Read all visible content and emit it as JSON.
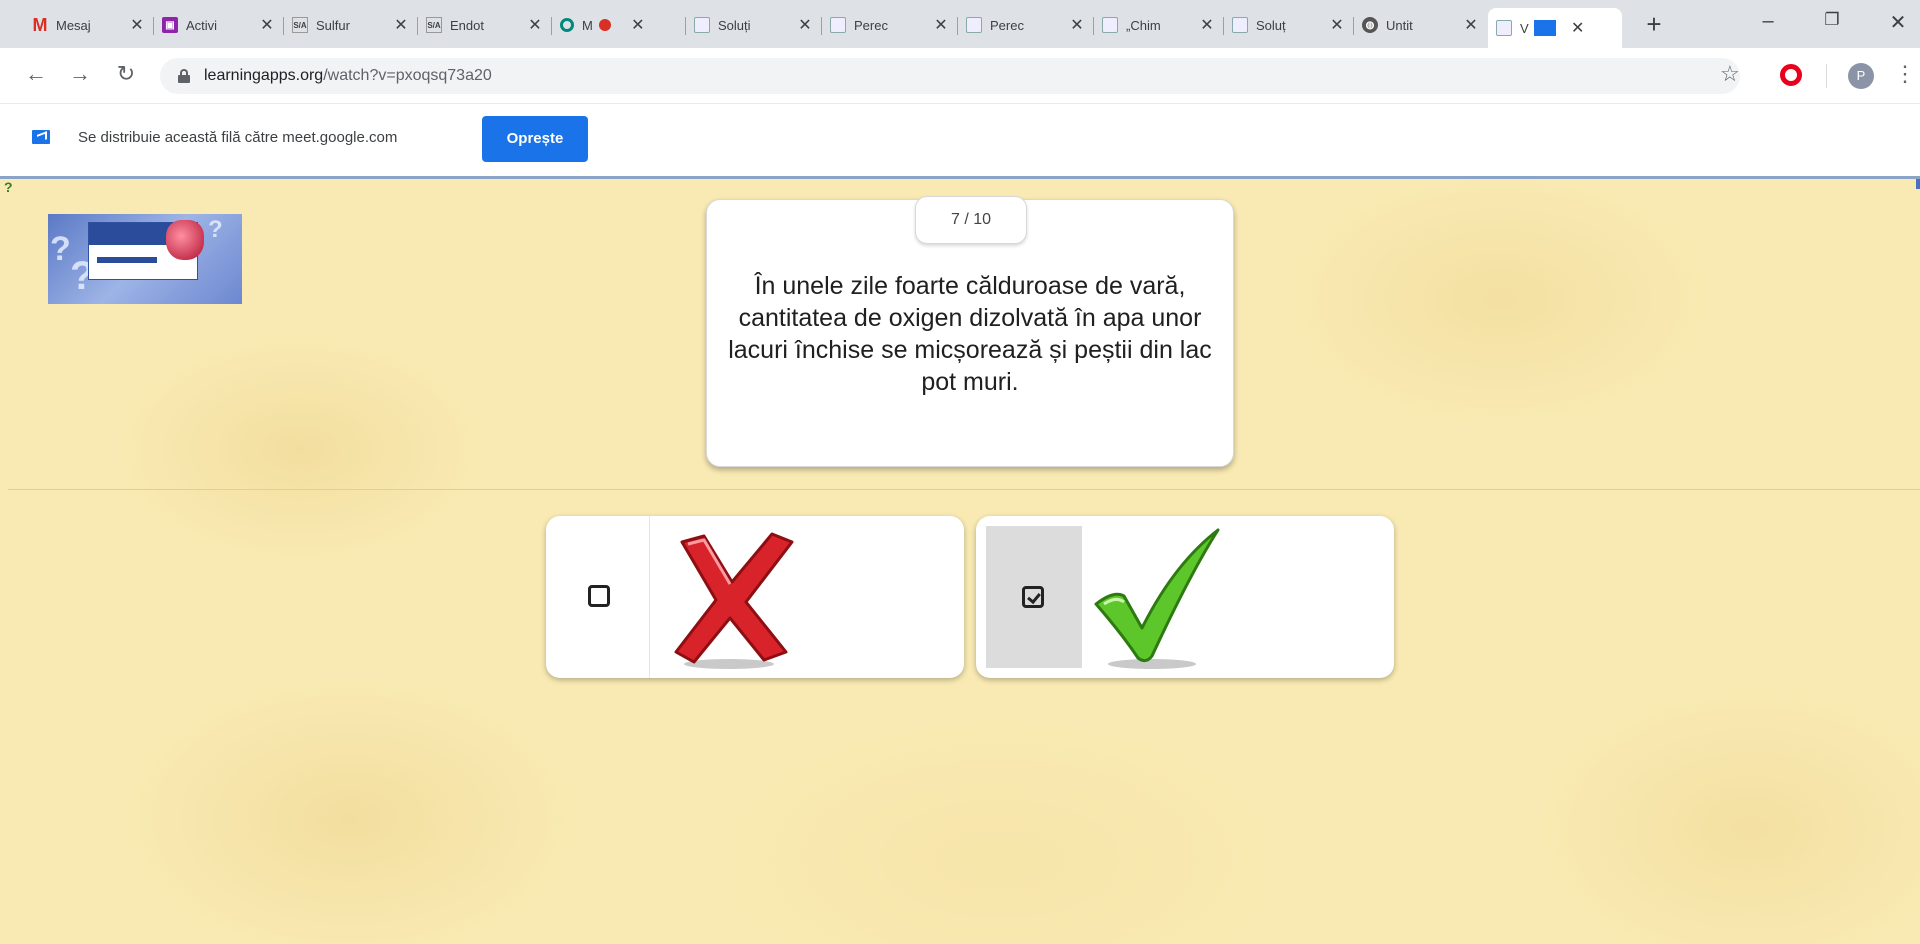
{
  "tabs": [
    {
      "label": "Mesaj",
      "icon": "gmail-icon"
    },
    {
      "label": "Activi",
      "icon": "classroom-icon"
    },
    {
      "label": "Sulfur",
      "icon": "sa-icon"
    },
    {
      "label": "Endot",
      "icon": "sa-icon"
    },
    {
      "label": "M",
      "icon": "meet-icon"
    },
    {
      "label": "Soluți",
      "icon": "learningapps-icon"
    },
    {
      "label": "Perec",
      "icon": "learningapps-icon"
    },
    {
      "label": "Perec",
      "icon": "learningapps-icon"
    },
    {
      "label": "„Chim",
      "icon": "learningapps-icon"
    },
    {
      "label": "Soluț",
      "icon": "learningapps-icon"
    },
    {
      "label": "Untit",
      "icon": "globe-icon"
    },
    {
      "label": "V",
      "icon": "learningapps-icon",
      "active": true
    }
  ],
  "toolbar": {
    "url_host": "learningapps.org",
    "url_path": "/watch?v=pxoqsq73a20",
    "profile_initial": "P"
  },
  "sharebar": {
    "message": "Se distribuie această filă către meet.google.com",
    "stop_label": "Oprește"
  },
  "quiz": {
    "counter": "7 / 10",
    "question": "În unele zile foarte călduroase de vară, cantitatea de oxigen dizolvată în apa unor lacuri închise se micșorează și peștii din lac pot muri.",
    "answers": [
      {
        "symbol": "false-cross-icon",
        "checked": false
      },
      {
        "symbol": "true-checkmark-icon",
        "checked": true
      }
    ]
  },
  "colors": {
    "accent": "#1a73e8",
    "background": "#f9eab3",
    "cross": "#d8232a",
    "check": "#5cc62a"
  }
}
